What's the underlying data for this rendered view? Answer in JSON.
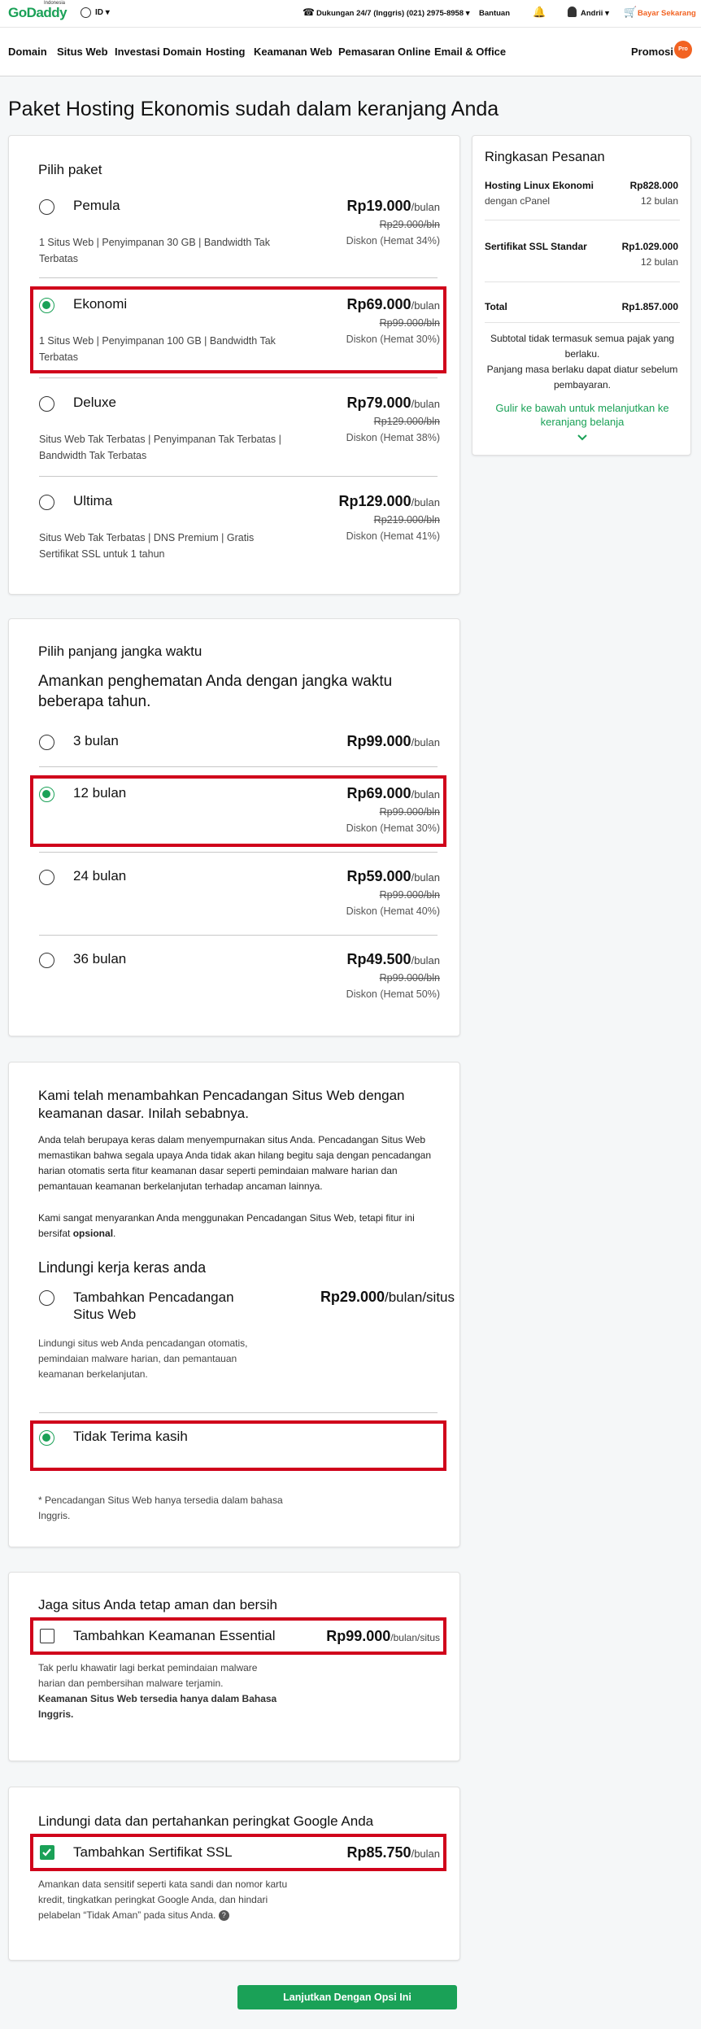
{
  "topbar": {
    "logo": "GoDaddy",
    "logo_small": "Indonesia",
    "locale": "ID",
    "support": "Dukungan 24/7 (Inggris) (021) 2975-8958",
    "help": "Bantuan",
    "user": "Andrii",
    "pay": "Bayar Sekarang"
  },
  "nav": {
    "items": [
      "Domain",
      "Situs Web",
      "Investasi Domain",
      "Hosting",
      "Keamanan Web",
      "Pemasaran Online",
      "Email & Office"
    ],
    "promo": "Promosi",
    "promo_badge": "Pro"
  },
  "page_title": "Paket Hosting Ekonomis sudah dalam keranjang Anda",
  "plan": {
    "heading": "Pilih paket",
    "options": [
      {
        "name": "Pemula",
        "price": "Rp19.000",
        "unit": "/bulan",
        "old": "Rp29.000/bln",
        "discount": "Diskon (Hemat 34%)",
        "desc": "1 Situs Web | Penyimpanan 30 GB | Bandwidth Tak Terbatas"
      },
      {
        "name": "Ekonomi",
        "price": "Rp69.000",
        "unit": "/bulan",
        "old": "Rp99.000/bln",
        "discount": "Diskon (Hemat 30%)",
        "desc": "1 Situs Web | Penyimpanan 100 GB | Bandwidth Tak Terbatas"
      },
      {
        "name": "Deluxe",
        "price": "Rp79.000",
        "unit": "/bulan",
        "old": "Rp129.000/bln",
        "discount": "Diskon (Hemat 38%)",
        "desc": "Situs Web Tak Terbatas | Penyimpanan Tak Terbatas | Bandwidth Tak Terbatas"
      },
      {
        "name": "Ultima",
        "price": "Rp129.000",
        "unit": "/bulan",
        "old": "Rp219.000/bln",
        "discount": "Diskon (Hemat 41%)",
        "desc": "Situs Web Tak Terbatas | DNS Premium | Gratis Sertifikat SSL untuk 1 tahun"
      }
    ]
  },
  "term": {
    "heading": "Pilih panjang jangka waktu",
    "subheading": "Amankan penghematan Anda dengan jangka waktu beberapa tahun.",
    "options": [
      {
        "name": "3 bulan",
        "price": "Rp99.000",
        "unit": "/bulan",
        "old": "",
        "discount": ""
      },
      {
        "name": "12 bulan",
        "price": "Rp69.000",
        "unit": "/bulan",
        "old": "Rp99.000/bln",
        "discount": "Diskon (Hemat 30%)"
      },
      {
        "name": "24 bulan",
        "price": "Rp59.000",
        "unit": "/bulan",
        "old": "Rp99.000/bln",
        "discount": "Diskon (Hemat 40%)"
      },
      {
        "name": "36 bulan",
        "price": "Rp49.500",
        "unit": "/bulan",
        "old": "Rp99.000/bln",
        "discount": "Diskon (Hemat 50%)"
      }
    ]
  },
  "backup": {
    "heading": "Kami telah menambahkan Pencadangan Situs Web dengan keamanan dasar. Inilah sebabnya.",
    "para1": "Anda telah berupaya keras dalam menyempurnakan situs Anda. Pencadangan Situs Web memastikan bahwa segala upaya Anda tidak akan hilang begitu saja dengan pencadangan harian otomatis serta fitur keamanan dasar seperti pemindaian malware harian dan pemantauan keamanan berkelanjutan terhadap ancaman lainnya.",
    "para2_a": "Kami sangat menyarankan Anda menggunakan Pencadangan Situs Web, tetapi fitur ini bersifat ",
    "para2_b": "opsional",
    "para2_c": ".",
    "protect_heading": "Lindungi kerja keras anda",
    "add_label": "Tambahkan Pencadangan Situs Web",
    "add_price": "Rp29.000",
    "add_unit": "/bulan/situs",
    "add_desc": "Lindungi situs web Anda pencadangan otomatis, pemindaian malware harian, dan pemantauan keamanan berkelanjutan.",
    "decline_label": "Tidak Terima kasih",
    "note": "* Pencadangan Situs Web hanya tersedia dalam bahasa Inggris."
  },
  "security": {
    "heading": "Jaga situs Anda tetap aman dan bersih",
    "label": "Tambahkan Keamanan Essential",
    "price": "Rp99.000",
    "unit": "/bulan/situs",
    "desc": "Tak perlu khawatir lagi berkat pemindaian malware harian dan pembersihan malware terjamin.",
    "note": "Keamanan Situs Web tersedia hanya dalam Bahasa Inggris."
  },
  "ssl": {
    "heading": "Lindungi data dan pertahankan peringkat Google Anda",
    "label": "Tambahkan Sertifikat SSL",
    "price": "Rp85.750",
    "unit": "/bulan",
    "desc": "Amankan data sensitif seperti kata sandi dan nomor kartu kredit, tingkatkan peringkat Google Anda, dan hindari pelabelan “Tidak Aman” pada situs Anda."
  },
  "continue_button": "Lanjutkan Dengan Opsi Ini",
  "summary": {
    "title": "Ringkasan Pesanan",
    "item1_name": "Hosting Linux Ekonomi",
    "item1_sub": "dengan cPanel",
    "item1_price": "Rp828.000",
    "item1_term": "12 bulan",
    "item2_name": "Sertifikat SSL Standar",
    "item2_price": "Rp1.029.000",
    "item2_term": "12 bulan",
    "total_label": "Total",
    "total_value": "Rp1.857.000",
    "note1": "Subtotal tidak termasuk semua pajak yang berlaku.",
    "note2": "Panjang masa berlaku dapat diatur sebelum pembayaran.",
    "scroll": "Gulir ke bawah untuk melanjutkan ke keranjang belanja"
  },
  "colors": {
    "brand": "#1aa157",
    "highlight": "#d0021b",
    "accent": "#f26322"
  }
}
